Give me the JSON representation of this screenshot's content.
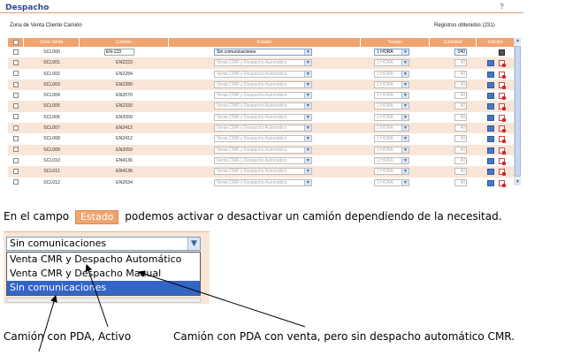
{
  "app": {
    "title": "Despacho",
    "zona_label": "Zona de Venta Cliente Camión",
    "registros": "Registros obtenidos (231)"
  },
  "grid": {
    "headers": [
      "Zona Venta",
      "Camión",
      "Estado",
      "Tiempo",
      "Cantidad",
      "Edición"
    ],
    "rows": [
      {
        "zona": "SCL000",
        "camion": "EN-123",
        "estado": "Sin comunicaciones",
        "tiempo": "1 HORA",
        "cantidad": "040",
        "active": true
      },
      {
        "zona": "SCL001",
        "camion": "EN2223",
        "estado": "Venta CMR y Despacho Automático",
        "tiempo": "1 HORA",
        "cantidad": "40",
        "active": false
      },
      {
        "zona": "SCL002",
        "camion": "EN2284",
        "estado": "Venta CMR y Despacho Automático",
        "tiempo": "1 HORA",
        "cantidad": "40",
        "active": false
      },
      {
        "zona": "SCL003",
        "camion": "EN2280",
        "estado": "Venta CMR y Despacho Automático",
        "tiempo": "1 HORA",
        "cantidad": "40",
        "active": false
      },
      {
        "zona": "SCL004",
        "camion": "EN2070",
        "estado": "Venta CMR y Despacho Automático",
        "tiempo": "1 HORA",
        "cantidad": "40",
        "active": false
      },
      {
        "zona": "SCL005",
        "camion": "EN2330",
        "estado": "Venta CMR y Despacho Automático",
        "tiempo": "1 HORA",
        "cantidad": "40",
        "active": false
      },
      {
        "zona": "SCL006",
        "camion": "EN2050",
        "estado": "Venta CMR y Despacho Automático",
        "tiempo": "1 HORA",
        "cantidad": "40",
        "active": false
      },
      {
        "zona": "SCL007",
        "camion": "EN2412",
        "estado": "Venta CMR y Despacho Automático",
        "tiempo": "1 HORA",
        "cantidad": "40",
        "active": false
      },
      {
        "zona": "SCL008",
        "camion": "EN2412",
        "estado": "Venta CMR y Despacho Automático",
        "tiempo": "1 HORA",
        "cantidad": "40",
        "active": false
      },
      {
        "zona": "SCL009",
        "camion": "EN2050",
        "estado": "Venta CMR y Despacho Automático",
        "tiempo": "1 HORA",
        "cantidad": "40",
        "active": false
      },
      {
        "zona": "SCL010",
        "camion": "EN4136",
        "estado": "Venta CMR y Despacho Automático",
        "tiempo": "1 HORA",
        "cantidad": "40",
        "active": false
      },
      {
        "zona": "SCL011",
        "camion": "EN4136",
        "estado": "Venta CMR y Despacho Automático",
        "tiempo": "1 HORA",
        "cantidad": "40",
        "active": false
      },
      {
        "zona": "SCL012",
        "camion": "EN2034",
        "estado": "Venta CMR y Despacho Automático",
        "tiempo": "1 HORA",
        "cantidad": "40",
        "active": false
      }
    ]
  },
  "explanation": {
    "before": "En el campo",
    "tag": "Estado",
    "after": "podemos activar o desactivar un camión dependiendo de la necesitad."
  },
  "dropdown": {
    "selected": "Sin comunicaciones",
    "options": [
      "Venta CMR y Despacho Automático",
      "Venta CMR y Despacho Manual",
      "Sin comunicaciones"
    ]
  },
  "captions": {
    "left": "Camión con PDA, Activo",
    "right": "Camión con PDA con venta, pero sin despacho automático CMR."
  },
  "colors": {
    "header": "#f0a470",
    "row_alt": "#f9e6d8",
    "selected_option": "#3365c8"
  }
}
